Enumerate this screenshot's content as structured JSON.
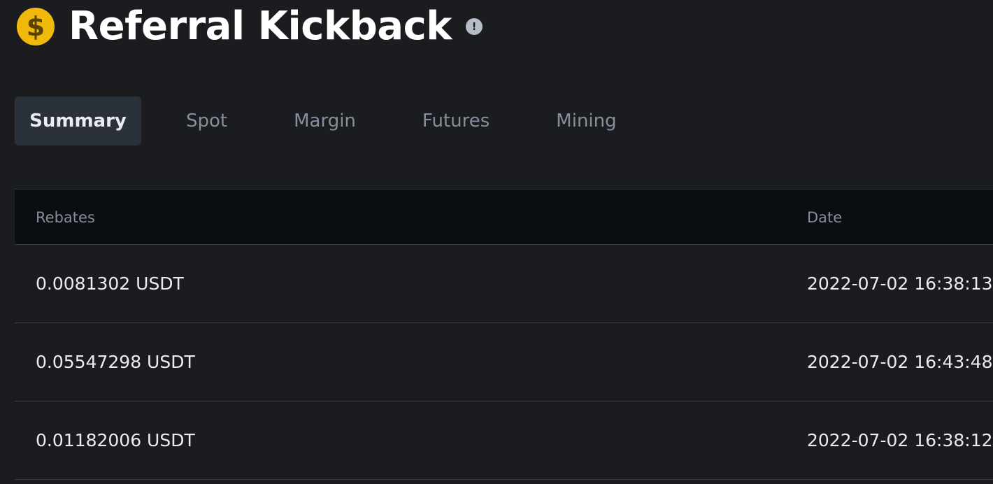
{
  "header": {
    "title": "Referral Kickback",
    "coin_icon": "dollar-coin-icon",
    "info_icon": "info-icon",
    "info_glyph": "!"
  },
  "colors": {
    "accent": "#f0b90b",
    "background": "#1b1c20",
    "table_header_bg": "#0b0e11",
    "active_tab_bg": "#2b3139",
    "muted_text": "#848e9c",
    "primary_text": "#eaecef"
  },
  "tabs": [
    {
      "label": "Summary",
      "active": true
    },
    {
      "label": "Spot",
      "active": false
    },
    {
      "label": "Margin",
      "active": false
    },
    {
      "label": "Futures",
      "active": false
    },
    {
      "label": "Mining",
      "active": false
    }
  ],
  "table": {
    "columns": [
      "Rebates",
      "Date"
    ],
    "rows": [
      {
        "rebate": "0.0081302 USDT",
        "date": "2022-07-02 16:38:13"
      },
      {
        "rebate": "0.05547298 USDT",
        "date": "2022-07-02 16:43:48"
      },
      {
        "rebate": "0.01182006 USDT",
        "date": "2022-07-02 16:38:12"
      }
    ]
  }
}
